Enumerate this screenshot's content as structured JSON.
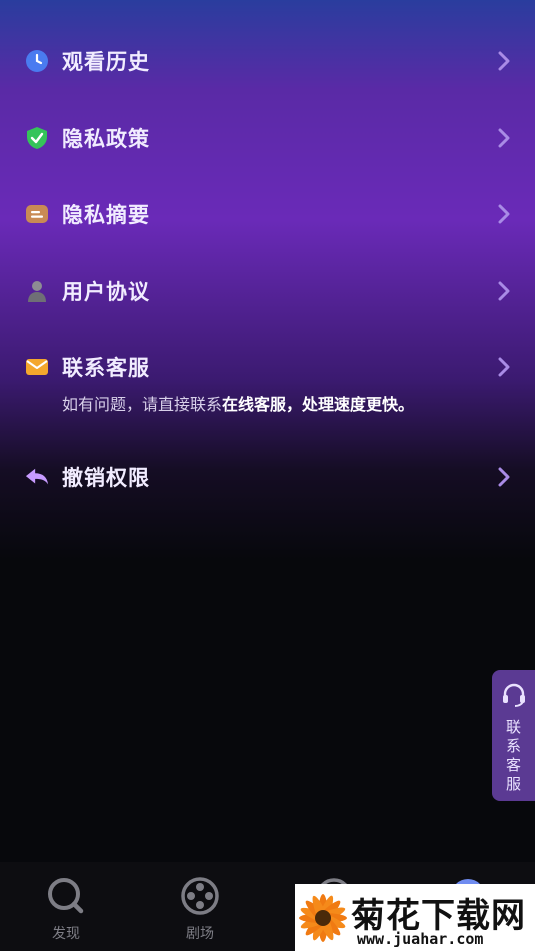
{
  "menu": {
    "items": [
      {
        "label": "观看历史",
        "icon": "clock-icon"
      },
      {
        "label": "隐私政策",
        "icon": "shield-check-icon"
      },
      {
        "label": "隐私摘要",
        "icon": "note-icon"
      },
      {
        "label": "用户协议",
        "icon": "user-icon"
      },
      {
        "label": "联系客服",
        "icon": "mail-icon"
      },
      {
        "label": "撤销权限",
        "icon": "undo-arrow-icon"
      }
    ]
  },
  "support_note": {
    "prefix": "如有问题，请直接联系",
    "highlight": "在线客服，处理速度更快。"
  },
  "float_service": {
    "label": "联系客服",
    "icon": "headset-icon"
  },
  "tabbar": {
    "tabs": [
      {
        "label": "发现",
        "icon": "discover-icon"
      },
      {
        "label": "剧场",
        "icon": "film-reel-icon"
      },
      {
        "label": "",
        "icon": "tab-3-icon"
      },
      {
        "label": "",
        "icon": "profile-tab-icon"
      }
    ]
  },
  "watermark": {
    "title": "菊花下载网",
    "url": "www.juahar.com"
  },
  "colors": {
    "accent": "#b48cff",
    "shield_green": "#35c45a",
    "clock_blue": "#4a7bf0",
    "envelope_orange": "#f4a72d",
    "note_tan": "#c98a55",
    "float_bg": "#5b3a93"
  }
}
